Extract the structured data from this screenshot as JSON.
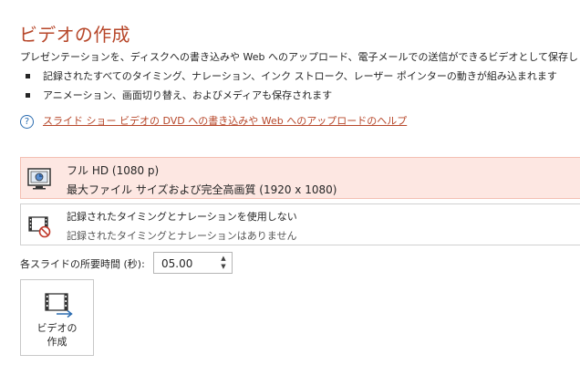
{
  "header": {
    "title": "ビデオの作成",
    "description": "プレゼンテーションを、ディスクへの書き込みや Web へのアップロード、電子メールでの送信ができるビデオとして保存します。"
  },
  "bullets": [
    "記録されたすべてのタイミング、ナレーション、インク ストローク、レーザー ポインターの動きが組み込まれます",
    "アニメーション、画面切り替え、およびメディアも保存されます"
  ],
  "help": {
    "icon": "help-circle-icon",
    "link_text": "スライド ショー ビデオの DVD への書き込みや Web へのアップロードのヘルプ"
  },
  "quality_option": {
    "icon": "monitor-icon",
    "title": "フル HD (1080 p)",
    "subtitle": "最大ファイル サイズおよび完全高画質 (1920 x 1080)"
  },
  "timing_option": {
    "icon": "film-no-icon",
    "title": "記録されたタイミングとナレーションを使用しない",
    "subtitle": "記録されたタイミングとナレーションはありません"
  },
  "duration": {
    "label": "各スライドの所要時間 (秒):",
    "value": "05.00",
    "up": "▲",
    "down": "▼"
  },
  "create_button": {
    "icon": "create-video-icon",
    "label": "ビデオの\n作成"
  },
  "colors": {
    "accent": "#b7472a",
    "selected_bg": "#fde7e2",
    "link_blue": "#2b6cb0"
  }
}
